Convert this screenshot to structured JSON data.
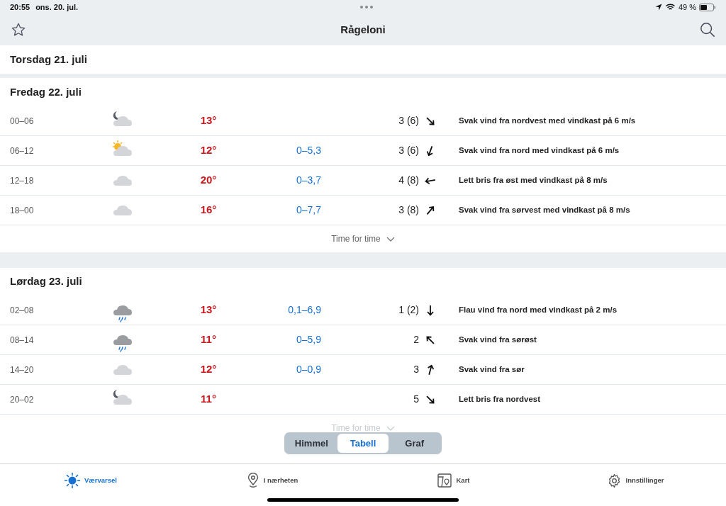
{
  "status_bar": {
    "time": "20:55",
    "date": "ons. 20. jul.",
    "battery": "49 %"
  },
  "nav": {
    "title": "Rågeloni"
  },
  "days": [
    {
      "title": "Torsdag 21. juli"
    },
    {
      "title": "Fredag 22. juli",
      "more": "Time for time",
      "more_faded": false,
      "rows": [
        {
          "time": "00–06",
          "kind": "moon-cloud",
          "temp": "13°",
          "precip": "",
          "wind": "3 (6)",
          "text": "Svak vind fra nordvest med vindkast på 6 m/s"
        },
        {
          "time": "06–12",
          "kind": "sun-cloud",
          "temp": "12°",
          "precip": "0–5,3",
          "wind": "3 (6)",
          "text": "Svak vind fra nord med vindkast på 6 m/s"
        },
        {
          "time": "12–18",
          "kind": "cloud",
          "temp": "20°",
          "precip": "0–3,7",
          "wind": "4 (8)",
          "text": "Lett bris fra øst med vindkast på 8 m/s"
        },
        {
          "time": "18–00",
          "kind": "cloud",
          "temp": "16°",
          "precip": "0–7,7",
          "wind": "3 (8)",
          "text": "Svak vind fra sørvest med vindkast på 8 m/s"
        }
      ]
    },
    {
      "title": "Lørdag 23. juli",
      "more": "Time for time",
      "more_faded": true,
      "rows": [
        {
          "time": "02–08",
          "kind": "rain-cloud",
          "temp": "13°",
          "precip": "0,1–6,9",
          "wind": "1 (2)",
          "text": "Flau vind fra nord med vindkast på 2 m/s"
        },
        {
          "time": "08–14",
          "kind": "rain-cloud",
          "temp": "11°",
          "precip": "0–5,9",
          "wind": "2",
          "text": "Svak vind fra sørøst"
        },
        {
          "time": "14–20",
          "kind": "cloud",
          "temp": "12°",
          "precip": "0–0,9",
          "wind": "3",
          "text": "Svak vind fra sør"
        },
        {
          "time": "20–02",
          "kind": "moon-cloud",
          "temp": "11°",
          "precip": "",
          "wind": "5",
          "text": "Lett bris fra nordvest"
        }
      ]
    }
  ],
  "segments": [
    {
      "label": "Himmel",
      "selected": false
    },
    {
      "label": "Tabell",
      "selected": true
    },
    {
      "label": "Graf",
      "selected": false
    }
  ],
  "tab_bar": [
    {
      "label": "Værvarsel",
      "selected": true
    },
    {
      "label": "I nærheten",
      "selected": false
    },
    {
      "label": "Kart",
      "selected": false
    },
    {
      "label": "Innstillinger",
      "selected": false
    }
  ]
}
